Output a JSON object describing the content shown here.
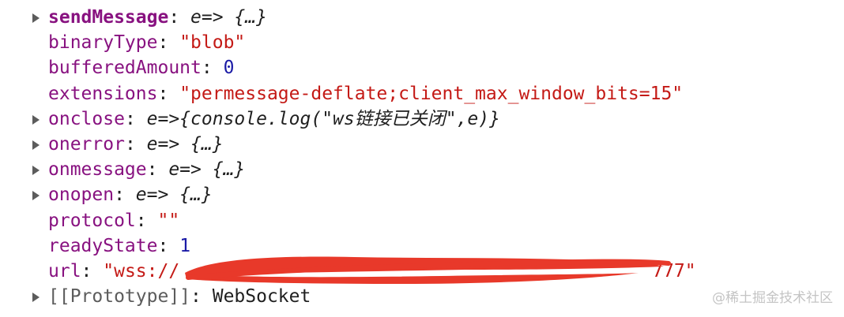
{
  "properties": [
    {
      "key": "sendMessage",
      "bold": true,
      "expandable": true,
      "value": "e=> {…}",
      "value_type": "function"
    },
    {
      "key": "binaryType",
      "bold": false,
      "expandable": false,
      "value": "\"blob\"",
      "value_type": "string"
    },
    {
      "key": "bufferedAmount",
      "bold": false,
      "expandable": false,
      "value": "0",
      "value_type": "number"
    },
    {
      "key": "extensions",
      "bold": false,
      "expandable": false,
      "value": "\"permessage-deflate;client_max_window_bits=15\"",
      "value_type": "string"
    },
    {
      "key": "onclose",
      "bold": false,
      "expandable": true,
      "value": "e=>{console.log(\"ws链接已关闭\",e)}",
      "value_type": "function"
    },
    {
      "key": "onerror",
      "bold": false,
      "expandable": true,
      "value": "e=> {…}",
      "value_type": "function"
    },
    {
      "key": "onmessage",
      "bold": false,
      "expandable": true,
      "value": "e=> {…}",
      "value_type": "function"
    },
    {
      "key": "onopen",
      "bold": false,
      "expandable": true,
      "value": "e=> {…}",
      "value_type": "function"
    },
    {
      "key": "protocol",
      "bold": false,
      "expandable": false,
      "value": "\"\"",
      "value_type": "string"
    },
    {
      "key": "readyState",
      "bold": false,
      "expandable": false,
      "value": "1",
      "value_type": "number"
    },
    {
      "key": "url",
      "bold": false,
      "expandable": false,
      "value": "\"wss://",
      "value_type": "string",
      "value_tail": "777\"",
      "redacted": true
    },
    {
      "key": "[[Prototype]]",
      "bold": false,
      "expandable": true,
      "value": "WebSocket",
      "value_type": "plain",
      "prototype": true
    }
  ],
  "separator": ": ",
  "watermark": "@稀土掘金技术社区",
  "colors": {
    "key": "#881280",
    "string": "#c41a16",
    "number": "#1a1aa6",
    "redaction": "#e8392a"
  }
}
